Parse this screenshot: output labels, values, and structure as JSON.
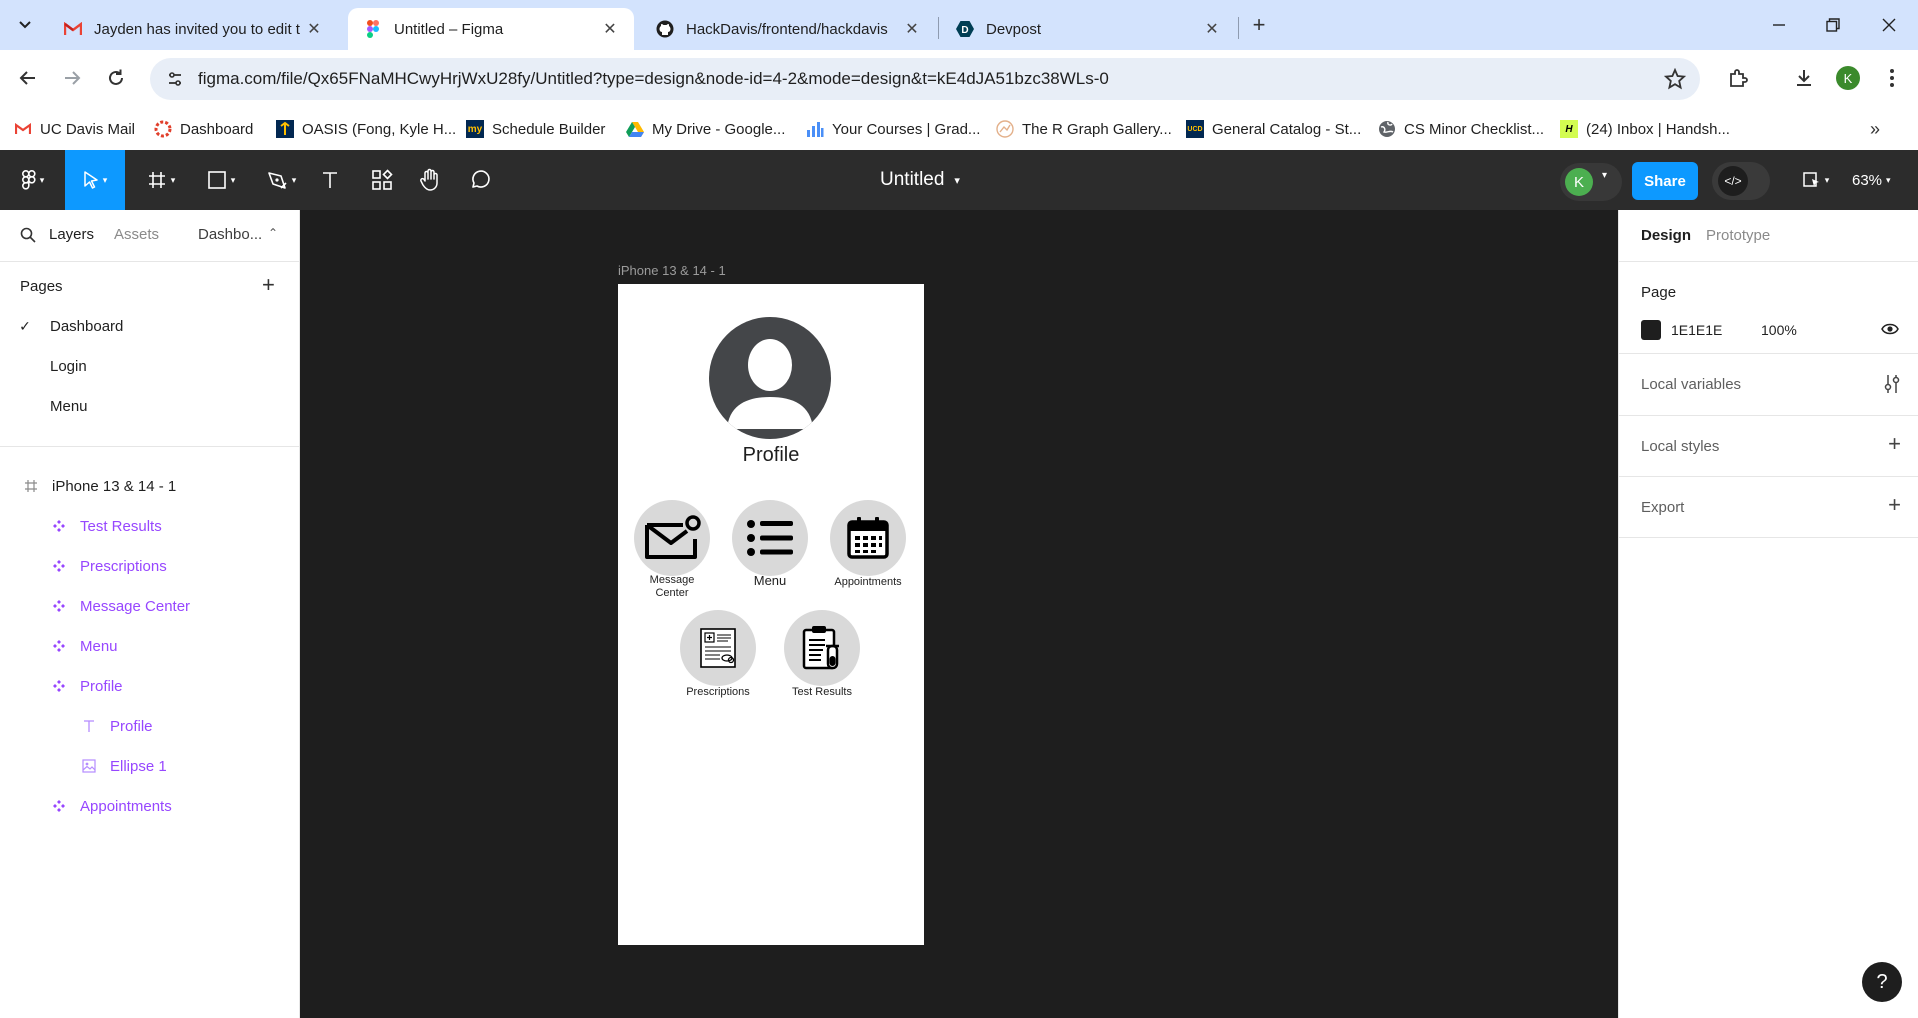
{
  "browser": {
    "tabs": [
      {
        "title": "Jayden has invited you to edit t",
        "favicon": "gmail-icon"
      },
      {
        "title": "Untitled – Figma",
        "favicon": "figma-icon"
      },
      {
        "title": "HackDavis/frontend/hackdavis",
        "favicon": "github-icon"
      },
      {
        "title": "Devpost",
        "favicon": "devpost-icon"
      }
    ],
    "url": "figma.com/file/Qx65FNaMHCwyHrjWxU28fy/Untitled?type=design&node-id=4-2&mode=design&t=kE4dJA51bzc38WLs-0",
    "profile_initial": "K",
    "bookmarks": [
      {
        "label": "UC Davis Mail"
      },
      {
        "label": "Dashboard"
      },
      {
        "label": "OASIS (Fong, Kyle H..."
      },
      {
        "label": "Schedule Builder"
      },
      {
        "label": "My Drive - Google..."
      },
      {
        "label": "Your Courses | Grad..."
      },
      {
        "label": "The R Graph Gallery..."
      },
      {
        "label": "General Catalog - St..."
      },
      {
        "label": "CS Minor Checklist..."
      },
      {
        "label": "(24) Inbox | Handsh..."
      }
    ]
  },
  "figma": {
    "file_title": "Untitled",
    "user_initial": "K",
    "share_label": "Share",
    "zoom": "63%"
  },
  "left_panel": {
    "tabs": {
      "layers": "Layers",
      "assets": "Assets",
      "page_switch": "Dashbo..."
    },
    "pages_title": "Pages",
    "pages": [
      {
        "name": "Dashboard",
        "selected": true
      },
      {
        "name": "Login",
        "selected": false
      },
      {
        "name": "Menu",
        "selected": false
      }
    ],
    "layers": [
      {
        "name": "iPhone 13 & 14 - 1",
        "kind": "frame"
      },
      {
        "name": "Test Results",
        "kind": "component"
      },
      {
        "name": "Prescriptions",
        "kind": "component"
      },
      {
        "name": "Message Center",
        "kind": "component"
      },
      {
        "name": "Menu",
        "kind": "component"
      },
      {
        "name": "Profile",
        "kind": "component"
      },
      {
        "name": "Profile",
        "kind": "text"
      },
      {
        "name": "Ellipse 1",
        "kind": "image"
      },
      {
        "name": "Appointments",
        "kind": "component"
      }
    ]
  },
  "canvas": {
    "frame_label": "iPhone 13 & 14 - 1",
    "profile_label": "Profile",
    "buttons": {
      "message_center": "Message Center",
      "menu": "Menu",
      "appointments": "Appointments",
      "prescriptions": "Prescriptions",
      "test_results": "Test Results"
    }
  },
  "right_panel": {
    "tabs": {
      "design": "Design",
      "prototype": "Prototype"
    },
    "page_title": "Page",
    "page_color": "1E1E1E",
    "page_opacity": "100%",
    "local_variables": "Local variables",
    "local_styles": "Local styles",
    "export": "Export"
  },
  "colors": {
    "figma_blue": "#0d99ff",
    "component_purple": "#9747ff",
    "canvas_bg": "#1e1e1e"
  }
}
